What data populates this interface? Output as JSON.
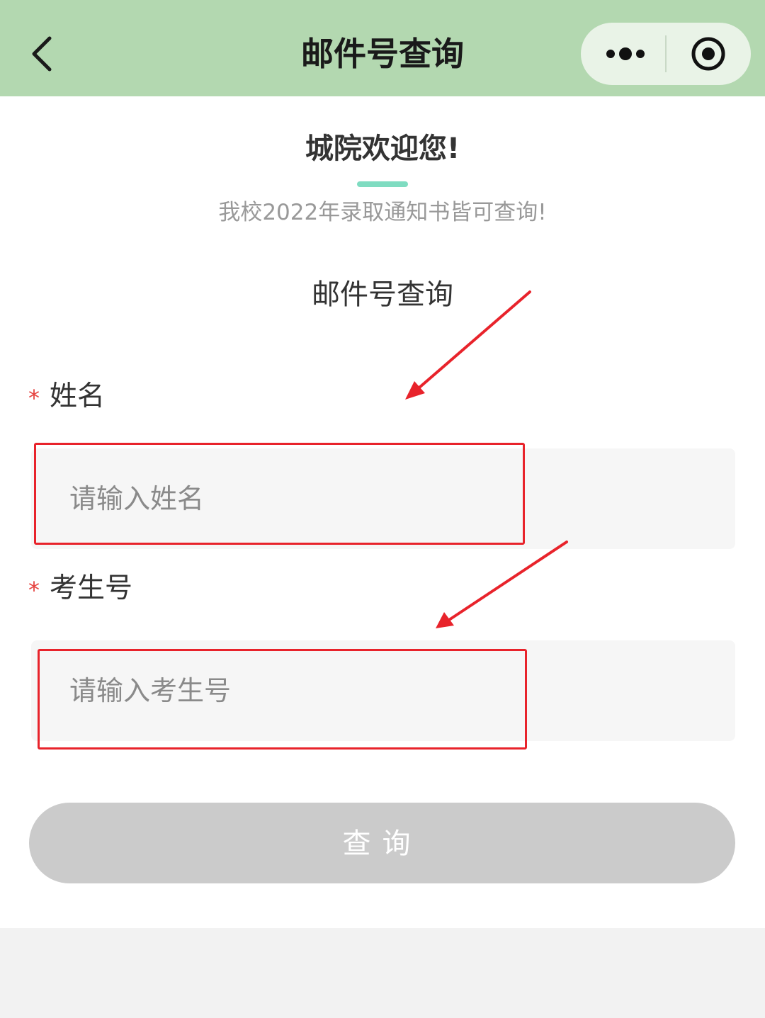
{
  "navbar": {
    "title": "邮件号查询",
    "back_icon": "chevron-left-icon",
    "more_icon": "more-dots-icon",
    "close_icon": "target-circle-icon"
  },
  "header": {
    "welcome": "城院欢迎您!",
    "subtitle": "我校2022年录取通知书皆可查询!"
  },
  "form": {
    "title": "邮件号查询",
    "required_mark": "*",
    "name_label": "姓名",
    "name_placeholder": "请输入姓名",
    "name_value": "",
    "exam_label": "考生号",
    "exam_placeholder": "请输入考生号",
    "exam_value": "",
    "submit_label": "查询"
  },
  "colors": {
    "navbar_bg": "#b3d8b0",
    "accent_bar": "#7fdcc1",
    "required_star": "#e64340",
    "annotation_red": "#e8232b",
    "button_disabled": "#cbcbcb"
  }
}
